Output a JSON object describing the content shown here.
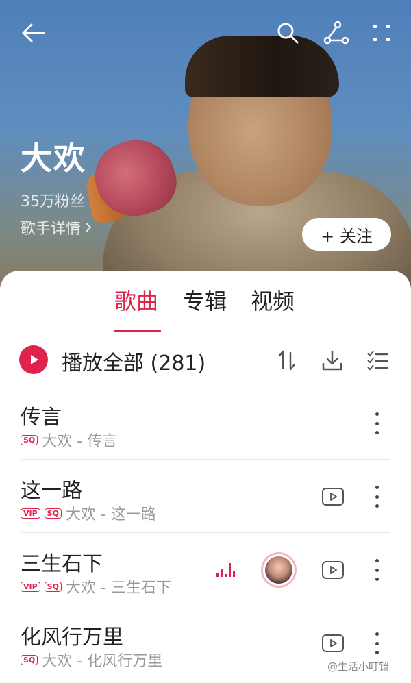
{
  "header": {
    "artist_name": "大欢",
    "fans": "35万粉丝",
    "detail_link": "歌手详情",
    "follow_label": "+ 关注"
  },
  "tabs": [
    {
      "label": "歌曲",
      "active": true
    },
    {
      "label": "专辑",
      "active": false
    },
    {
      "label": "视频",
      "active": false
    }
  ],
  "play_all": {
    "label": "播放全部 (281)"
  },
  "songs": [
    {
      "title": "传言",
      "badges": [
        "SQ"
      ],
      "subtitle": "大欢 - 传言",
      "has_mv": false,
      "playing": false
    },
    {
      "title": "这一路",
      "badges": [
        "VIP",
        "SQ"
      ],
      "subtitle": "大欢 - 这一路",
      "has_mv": true,
      "playing": false
    },
    {
      "title": "三生石下",
      "badges": [
        "VIP",
        "SQ"
      ],
      "subtitle": "大欢 - 三生石下",
      "has_mv": true,
      "playing": true
    },
    {
      "title": "化风行万里",
      "badges": [
        "SQ"
      ],
      "subtitle": "大欢 - 化风行万里",
      "has_mv": true,
      "playing": false
    }
  ],
  "watermark": "@生活小叮铛",
  "colors": {
    "accent": "#e0234d"
  },
  "icons": [
    "back-arrow-icon",
    "search-icon",
    "share-icon",
    "more-icon",
    "play-icon",
    "sort-icon",
    "download-icon",
    "multi-select-icon",
    "mv-icon",
    "more-vertical-icon",
    "equalizer-icon"
  ]
}
